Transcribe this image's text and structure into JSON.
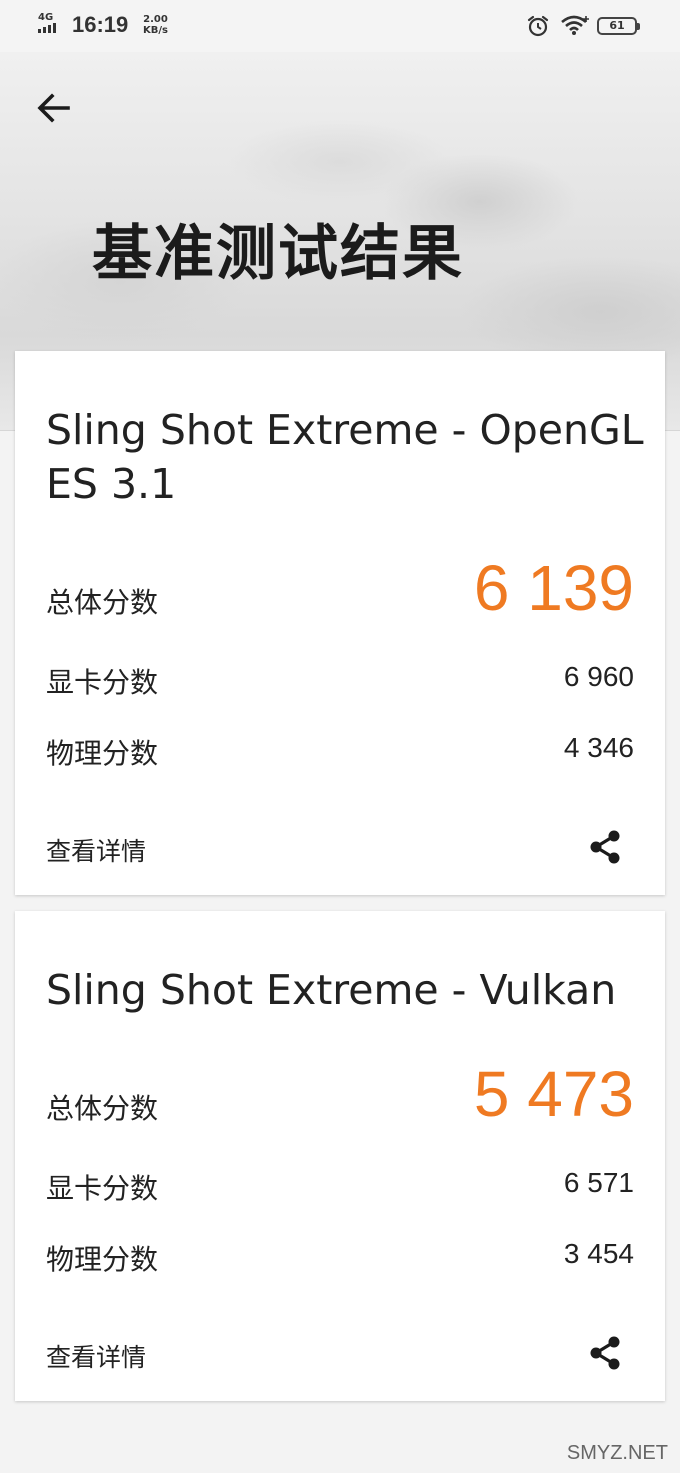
{
  "status_bar": {
    "network": "4G",
    "time": "16:19",
    "speed_value": "2.00",
    "speed_unit": "KB/s",
    "battery": "61"
  },
  "header": {
    "title": "基准测试结果"
  },
  "results": [
    {
      "title": "Sling Shot Extreme - OpenGL ES 3.1",
      "overall_label": "总体分数",
      "overall_score": "6 139",
      "graphics_label": "显卡分数",
      "graphics_score": "6 960",
      "physics_label": "物理分数",
      "physics_score": "4 346",
      "details_label": "查看详情"
    },
    {
      "title": "Sling Shot Extreme - Vulkan",
      "overall_label": "总体分数",
      "overall_score": "5 473",
      "graphics_label": "显卡分数",
      "graphics_score": "6 571",
      "physics_label": "物理分数",
      "physics_score": "3 454",
      "details_label": "查看详情"
    }
  ],
  "watermark": "SMYZ.NET",
  "colors": {
    "accent": "#ef7a22",
    "background": "#f3f3f3",
    "card": "#ffffff"
  },
  "icons": [
    "back-arrow-icon",
    "share-icon",
    "alarm-icon",
    "wifi-icon",
    "signal-icon",
    "battery-icon"
  ]
}
